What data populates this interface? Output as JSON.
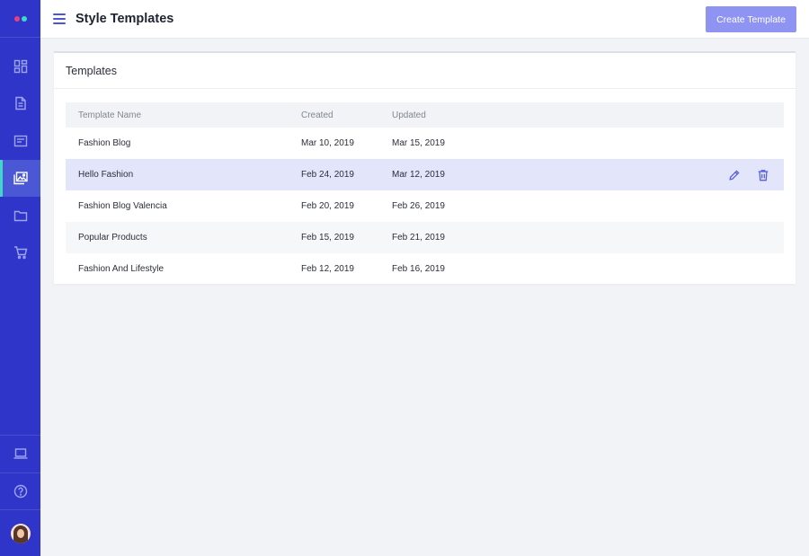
{
  "colors": {
    "sidebar_bg": "#2f35c9",
    "accent": "#41d7c9",
    "logo_dot_pink": "#e8407d",
    "logo_dot_teal": "#41d7c9",
    "primary_button": "#8f94f2",
    "selected_row": "#e3e5fb"
  },
  "sidebar": {
    "logo": "logo-dots",
    "items": [
      {
        "icon": "dashboard-icon",
        "active": false
      },
      {
        "icon": "document-icon",
        "active": false
      },
      {
        "icon": "card-icon",
        "active": false
      },
      {
        "icon": "images-icon",
        "active": true
      },
      {
        "icon": "folder-icon",
        "active": false
      },
      {
        "icon": "cart-icon",
        "active": false
      }
    ],
    "bottom_items": [
      {
        "icon": "laptop-icon"
      },
      {
        "icon": "help-icon"
      }
    ],
    "avatar": "user-avatar"
  },
  "header": {
    "title": "Style Templates",
    "create_button": "Create Template"
  },
  "card": {
    "title": "Templates",
    "columns": [
      "Template Name",
      "Created",
      "Updated"
    ],
    "rows": [
      {
        "name": "Fashion Blog",
        "created": "Mar 10, 2019",
        "updated": "Mar 15, 2019"
      },
      {
        "name": "Hello Fashion",
        "created": "Feb 24, 2019",
        "updated": "Mar 12, 2019"
      },
      {
        "name": "Fashion Blog Valencia",
        "created": "Feb 20, 2019",
        "updated": "Feb 26, 2019"
      },
      {
        "name": "Popular Products",
        "created": "Feb 15, 2019",
        "updated": "Feb 21, 2019"
      },
      {
        "name": "Fashion And Lifestyle",
        "created": "Feb 12, 2019",
        "updated": "Feb 16, 2019"
      }
    ],
    "row_actions": [
      "edit-icon",
      "trash-icon"
    ]
  }
}
